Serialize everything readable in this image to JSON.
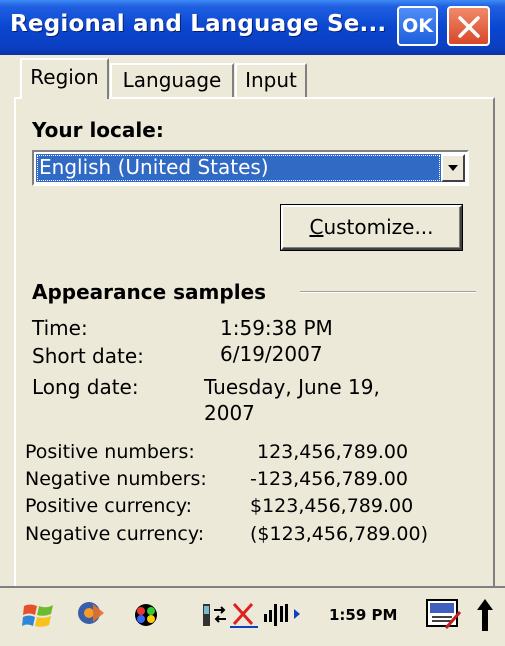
{
  "window": {
    "title": "Regional and Language Se...",
    "ok_label": "OK"
  },
  "tabs": [
    {
      "label": "Region"
    },
    {
      "label": "Language"
    },
    {
      "label": "Input"
    }
  ],
  "locale": {
    "label": "Your locale:",
    "selected": "English (United States)"
  },
  "customize_label": "Customize...",
  "samples": {
    "heading": "Appearance samples",
    "time_label": "Time:",
    "time_value": "1:59:38 PM",
    "short_date_label": "Short date:",
    "short_date_value": "6/19/2007",
    "long_date_label": "Long date:",
    "long_date_value_line1": "Tuesday, June 19,",
    "long_date_value_line2": "2007",
    "positive_numbers_label": "Positive numbers:",
    "positive_numbers_value": "123,456,789.00",
    "negative_numbers_label": "Negative numbers:",
    "negative_numbers_value": "-123,456,789.00",
    "positive_currency_label": "Positive currency:",
    "positive_currency_value": "$123,456,789.00",
    "negative_currency_label": "Negative currency:",
    "negative_currency_value": "($123,456,789.00)"
  },
  "taskbar": {
    "clock": "1:59 PM",
    "icons": [
      "windows-start-icon",
      "media-icon",
      "messenger-icon",
      "connectivity-icon",
      "network-disconnected-icon",
      "signal-icon",
      "input-panel-icon",
      "arrow-up-icon"
    ]
  },
  "colors": {
    "titlebar": "#0a46d1",
    "selection": "#316ac5",
    "close": "#d8472a",
    "face": "#ece9d8"
  }
}
